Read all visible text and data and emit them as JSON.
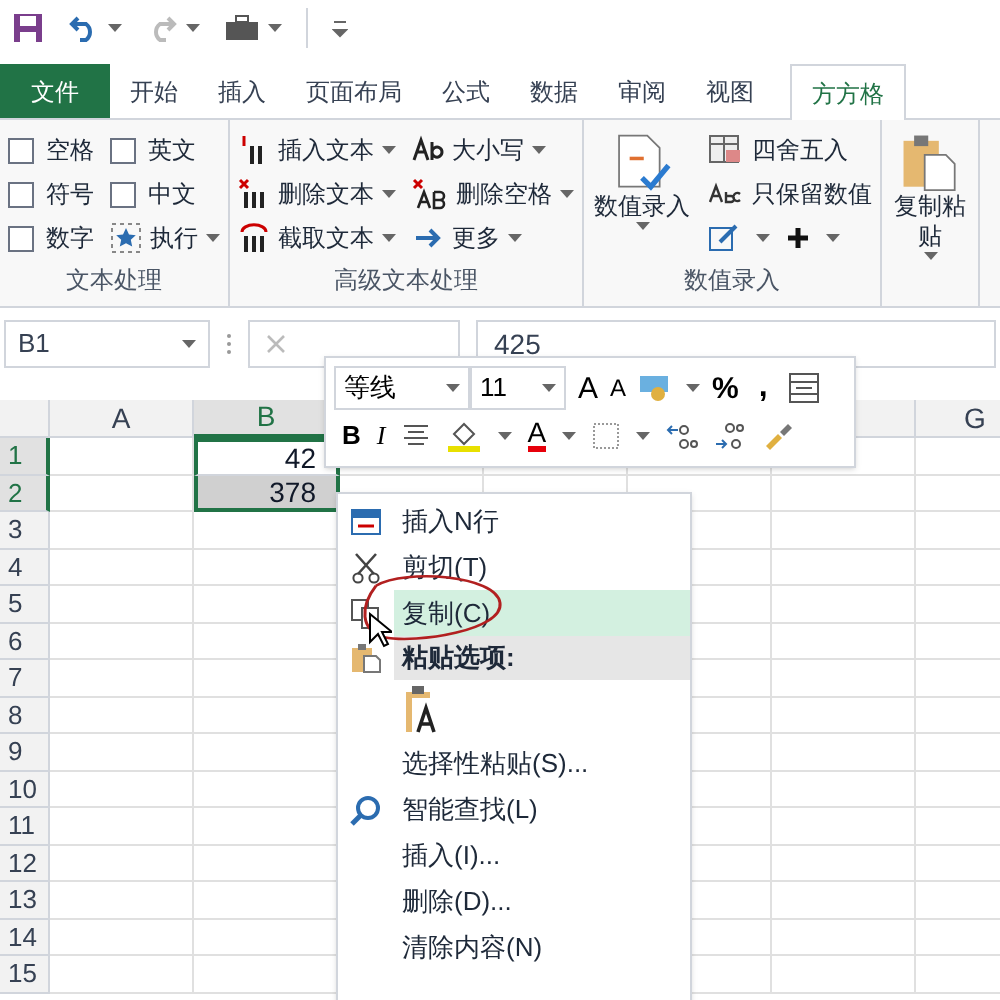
{
  "tabs": [
    {
      "label": "文件",
      "kind": "file",
      "selected": false
    },
    {
      "label": "开始",
      "kind": "tab",
      "selected": false
    },
    {
      "label": "插入",
      "kind": "tab",
      "selected": false
    },
    {
      "label": "页面布局",
      "kind": "tab",
      "selected": false
    },
    {
      "label": "公式",
      "kind": "tab",
      "selected": false
    },
    {
      "label": "数据",
      "kind": "tab",
      "selected": false
    },
    {
      "label": "审阅",
      "kind": "tab",
      "selected": false
    },
    {
      "label": "视图",
      "kind": "tab",
      "selected": false
    },
    {
      "label": "方方格",
      "kind": "tab",
      "selected": true
    }
  ],
  "ribbon": {
    "groups": [
      {
        "label": "文本处理",
        "columns": [
          [
            {
              "kind": "checkbox",
              "label": "空格",
              "checked": false
            },
            {
              "kind": "checkbox",
              "label": "符号",
              "checked": false
            },
            {
              "kind": "checkbox",
              "label": "数字",
              "checked": false
            }
          ],
          [
            {
              "kind": "checkbox",
              "label": "英文",
              "checked": false
            },
            {
              "kind": "checkbox",
              "label": "中文",
              "checked": false
            },
            {
              "kind": "command",
              "label": "执行"
            }
          ]
        ]
      },
      {
        "label": "高级文本处理",
        "columns": [
          [
            {
              "kind": "command",
              "label": "插入文本"
            },
            {
              "kind": "command",
              "label": "删除文本"
            },
            {
              "kind": "command",
              "label": "截取文本"
            }
          ],
          [
            {
              "kind": "command",
              "label": "大小写"
            },
            {
              "kind": "command",
              "label": "删除空格"
            },
            {
              "kind": "command",
              "label": "更多"
            }
          ]
        ]
      },
      {
        "label": "数值录入",
        "columns": [
          [
            {
              "kind": "large",
              "label": "数值录入"
            }
          ],
          [
            {
              "kind": "plain",
              "label": "四舍五入"
            },
            {
              "kind": "plain",
              "label": "只保留数值"
            },
            {
              "kind": "icons"
            }
          ]
        ]
      },
      {
        "columns": [
          [
            {
              "kind": "large",
              "label": "复制粘贴"
            }
          ]
        ]
      }
    ]
  },
  "formula_bar": {
    "name_box": "B1",
    "formula": "425"
  },
  "mini_toolbar": {
    "font": "等线",
    "size": "11",
    "row1_glyphs": [
      "A",
      "A",
      "%",
      ","
    ],
    "row2_glyphs": [
      "B",
      "I"
    ],
    "font_color_glyph": "A"
  },
  "sheet": {
    "columns": [
      {
        "label": "A",
        "selected": false
      },
      {
        "label": "B",
        "selected": true
      },
      {
        "label": "G",
        "selected": false
      }
    ],
    "rows": [
      {
        "label": "1",
        "selected": true,
        "value_b": "42"
      },
      {
        "label": "2",
        "selected": true,
        "value_b": "378"
      },
      {
        "label": "3",
        "selected": false
      },
      {
        "label": "4",
        "selected": false
      },
      {
        "label": "5",
        "selected": false
      },
      {
        "label": "6",
        "selected": false
      },
      {
        "label": "7",
        "selected": false
      },
      {
        "label": "8",
        "selected": false
      },
      {
        "label": "9",
        "selected": false
      },
      {
        "label": "10",
        "selected": false
      },
      {
        "label": "11",
        "selected": false
      },
      {
        "label": "12",
        "selected": false
      },
      {
        "label": "13",
        "selected": false
      },
      {
        "label": "14",
        "selected": false
      },
      {
        "label": "15",
        "selected": false
      }
    ]
  },
  "context_menu": [
    {
      "kind": "item",
      "label": "插入N行",
      "selected": false
    },
    {
      "kind": "item",
      "label": "剪切(T)",
      "selected": false
    },
    {
      "kind": "item",
      "label": "复制(C)",
      "selected": true
    },
    {
      "kind": "header",
      "label": "粘贴选项:"
    },
    {
      "kind": "paste"
    },
    {
      "kind": "item",
      "label": "选择性粘贴(S)...",
      "selected": false
    },
    {
      "kind": "item",
      "label": "智能查找(L)",
      "selected": false
    },
    {
      "kind": "item",
      "label": "插入(I)...",
      "selected": false
    },
    {
      "kind": "item",
      "label": "删除(D)...",
      "selected": false
    },
    {
      "kind": "item",
      "label": "清除内容(N)",
      "selected": false
    }
  ]
}
